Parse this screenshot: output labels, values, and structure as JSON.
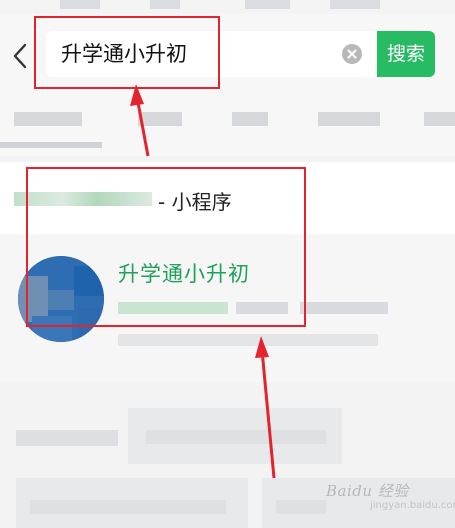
{
  "header": {
    "search_value": "升学通小升初",
    "search_button_label": "搜索"
  },
  "results": {
    "section_title": "- 小程序",
    "app_name": "升学通小升初"
  },
  "watermark": {
    "text": "Baidu 经验",
    "sub": "jingyan.baidu.com"
  },
  "colors": {
    "accent": "#27bb63",
    "app_name": "#1fa05b",
    "annotation": "#e3232e"
  },
  "icons": [
    "back-chevron-icon",
    "clear-icon",
    "app-logo"
  ]
}
